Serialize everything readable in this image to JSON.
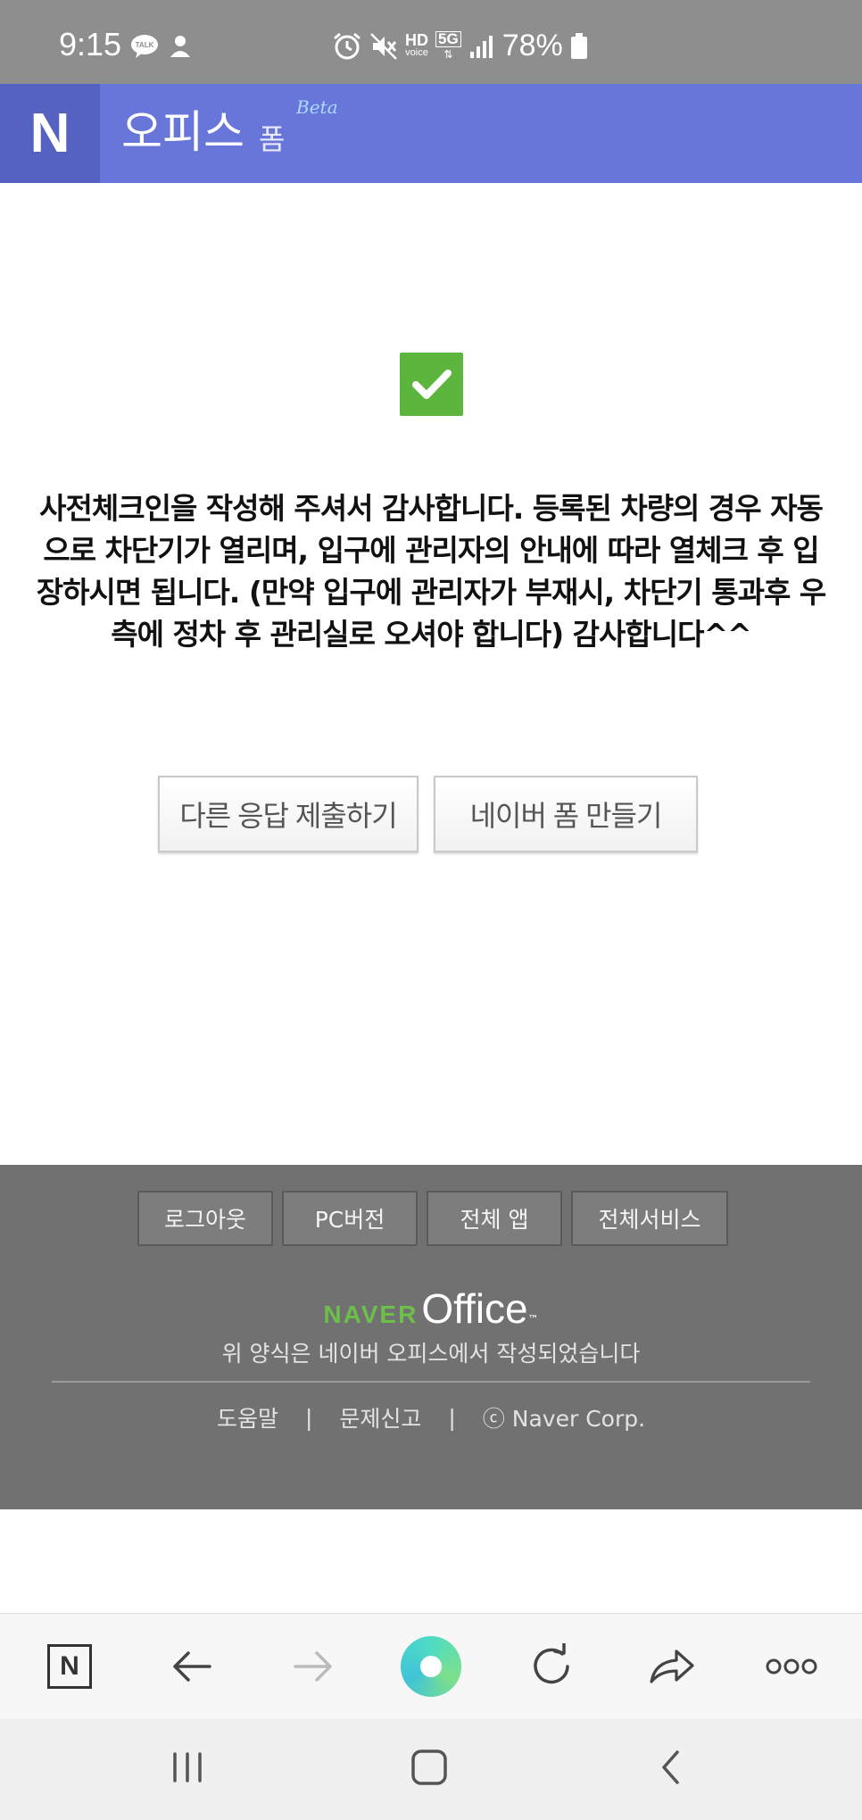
{
  "status_bar": {
    "time": "9:15",
    "left_icons": [
      "talk-icon",
      "notification-person-icon"
    ],
    "network_label": "HD",
    "network_sublabel": "voice",
    "network_type": "5G",
    "battery": "78%"
  },
  "header": {
    "logo_letter": "N",
    "title": "오피스",
    "subtitle": "폼",
    "beta": "Beta"
  },
  "main": {
    "message": "사전체크인을 작성해 주셔서 감사합니다. 등록된 차량의 경우 자동으로 차단기가 열리며, 입구에 관리자의 안내에 따라 열체크 후 입장하시면 됩니다. (만약 입구에 관리자가 부재시, 차단기 통과후 우측에 정차 후 관리실로 오셔야 합니다) 감사합니다^^",
    "buttons": {
      "submit_another": "다른 응답 제출하기",
      "create_form": "네이버 폼 만들기"
    }
  },
  "footer": {
    "buttons": {
      "logout": "로그아웃",
      "pc_version": "PC버전",
      "all_apps": "전체 앱",
      "all_services": "전체서비스"
    },
    "brand_naver": "NAVER",
    "brand_office": "Office",
    "brand_tm": "™",
    "made_with": "위 양식은 네이버 오피스에서 작성되었습니다",
    "links": {
      "help": "도움말",
      "report": "문제신고",
      "copyright": "ⓒ Naver Corp."
    },
    "separator": "|"
  },
  "browser_toolbar": {
    "home_letter": "N",
    "icons": [
      "naver-home-icon",
      "back-arrow-icon",
      "forward-arrow-icon",
      "green-dot-icon",
      "refresh-icon",
      "share-icon",
      "more-icon"
    ]
  },
  "colors": {
    "header_bg": "#6776d8",
    "logo_bg": "#5562c2",
    "check_green": "#5cb53c",
    "footer_bg": "#717171",
    "naver_green": "#6cc04a"
  }
}
